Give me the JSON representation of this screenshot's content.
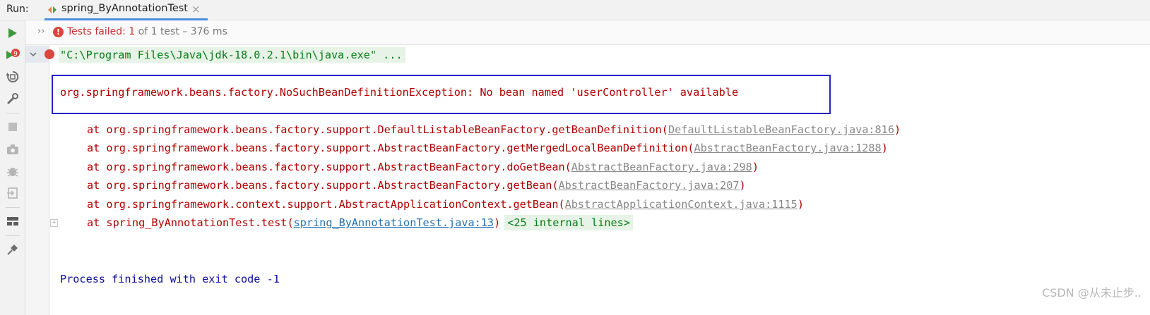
{
  "runbar": {
    "label": "Run:",
    "tab_title": "spring_ByAnnotationTest",
    "tab_close": "×"
  },
  "toolbar": {
    "icons": [
      "rerun-icon",
      "rerun-failed-icon",
      "toggle-auto-test-icon",
      "settings-wrench-icon",
      "stop-icon",
      "screenshot-icon",
      "debug-icon",
      "exit-icon",
      "layout-icon",
      "pin-icon"
    ],
    "failed_badge": "9",
    "accent": "#3c9a3c"
  },
  "status": {
    "expand": "››",
    "fail_icon": "!",
    "failed_text": "Tests failed: 1",
    "rest_text": " of 1 test – 376 ms"
  },
  "console": {
    "command": "\"C:\\Program Files\\Java\\jdk-18.0.2.1\\bin\\java.exe\" ...",
    "exception": "org.springframework.beans.factory.NoSuchBeanDefinitionException: No bean named 'userController' available",
    "stack": [
      {
        "prefix": "at org.springframework.beans.factory.support.DefaultListableBeanFactory.getBeanDefinition(",
        "link": "DefaultListableBeanFactory.java:816",
        "suffix": ")"
      },
      {
        "prefix": "at org.springframework.beans.factory.support.AbstractBeanFactory.getMergedLocalBeanDefinition(",
        "link": "AbstractBeanFactory.java:1288",
        "suffix": ")"
      },
      {
        "prefix": "at org.springframework.beans.factory.support.AbstractBeanFactory.doGetBean(",
        "link": "AbstractBeanFactory.java:298",
        "suffix": ")"
      },
      {
        "prefix": "at org.springframework.beans.factory.support.AbstractBeanFactory.getBean(",
        "link": "AbstractBeanFactory.java:207",
        "suffix": ")"
      },
      {
        "prefix": "at org.springframework.context.support.AbstractApplicationContext.getBean(",
        "link": "AbstractApplicationContext.java:1115",
        "suffix": ")"
      }
    ],
    "user_frame": {
      "prefix": "at spring_ByAnnotationTest.test(",
      "link": "spring_ByAnnotationTest.java:13",
      "suffix": ")",
      "internal": "<25 internal lines>"
    },
    "finished": "Process finished with exit code -1"
  },
  "watermark": "CSDN @从未止步.."
}
